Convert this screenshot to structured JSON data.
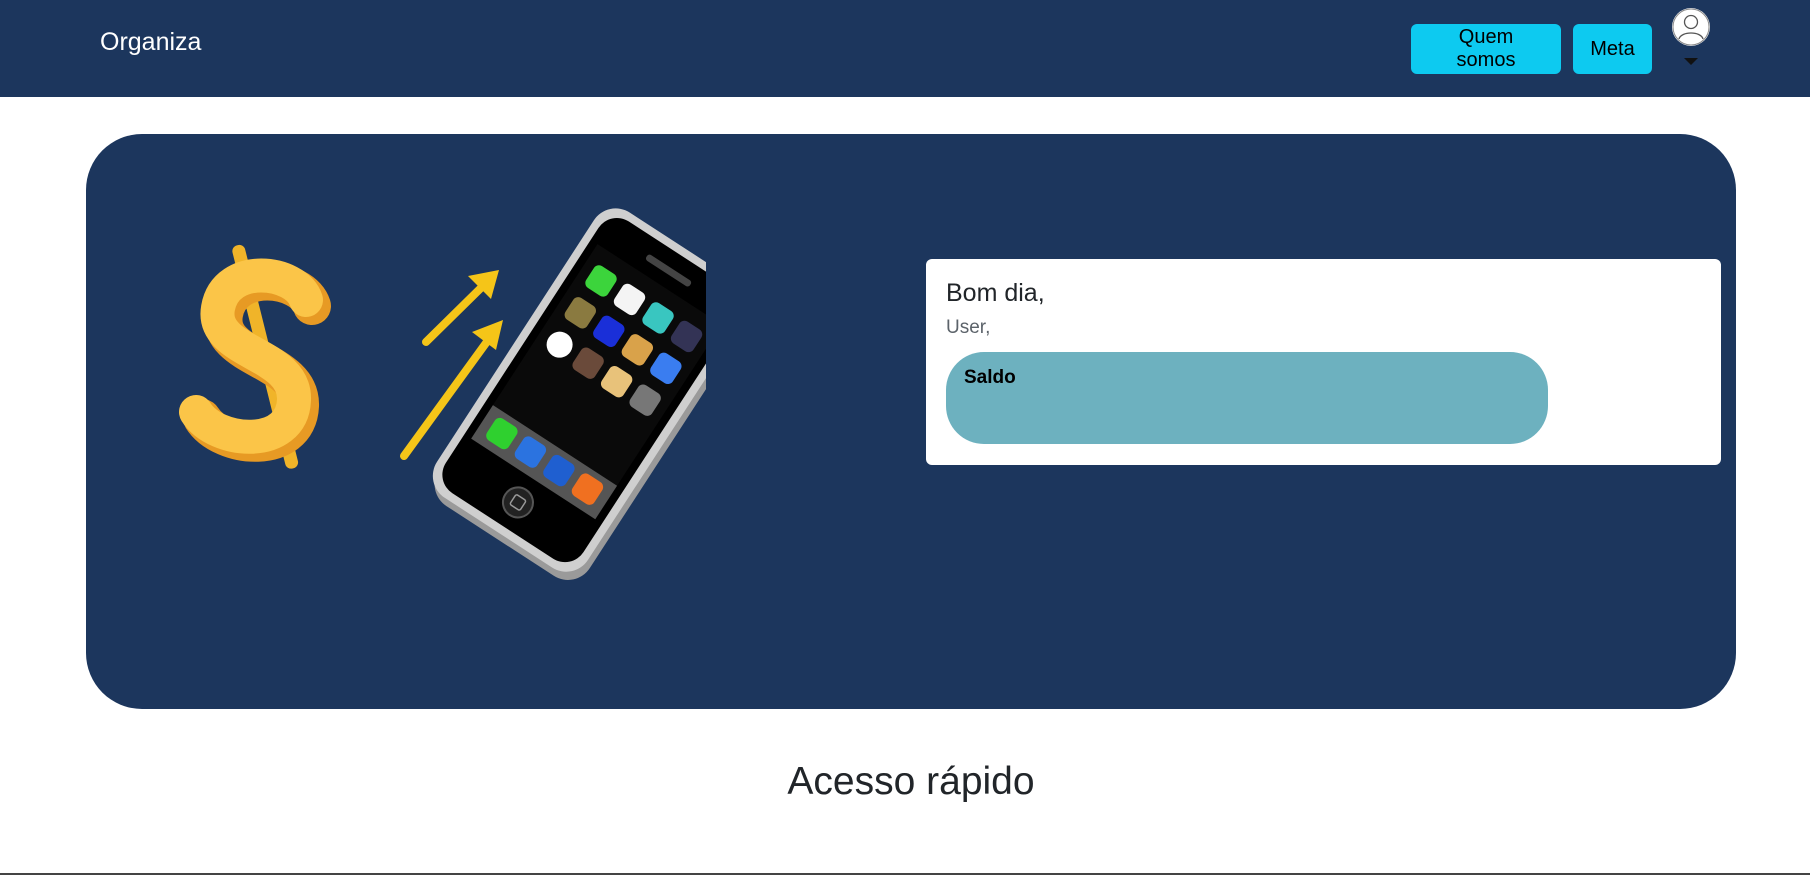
{
  "navbar": {
    "brand": "Organiza",
    "buttons": [
      {
        "label": "Quem somos"
      },
      {
        "label": "Meta"
      }
    ],
    "avatar_icon": "user-avatar-icon",
    "dropdown_icon": "caret-down-icon"
  },
  "hero": {
    "illustration": "money-phone-growth-illustration",
    "card": {
      "greeting": "Bom dia,",
      "user": "User,",
      "balance_label": "Saldo"
    }
  },
  "quick_access": {
    "title": "Acesso rápido"
  },
  "colors": {
    "navbar_bg": "#1c365d",
    "button_bg": "#0dcaf0",
    "balance_bg": "#6db1bf"
  }
}
